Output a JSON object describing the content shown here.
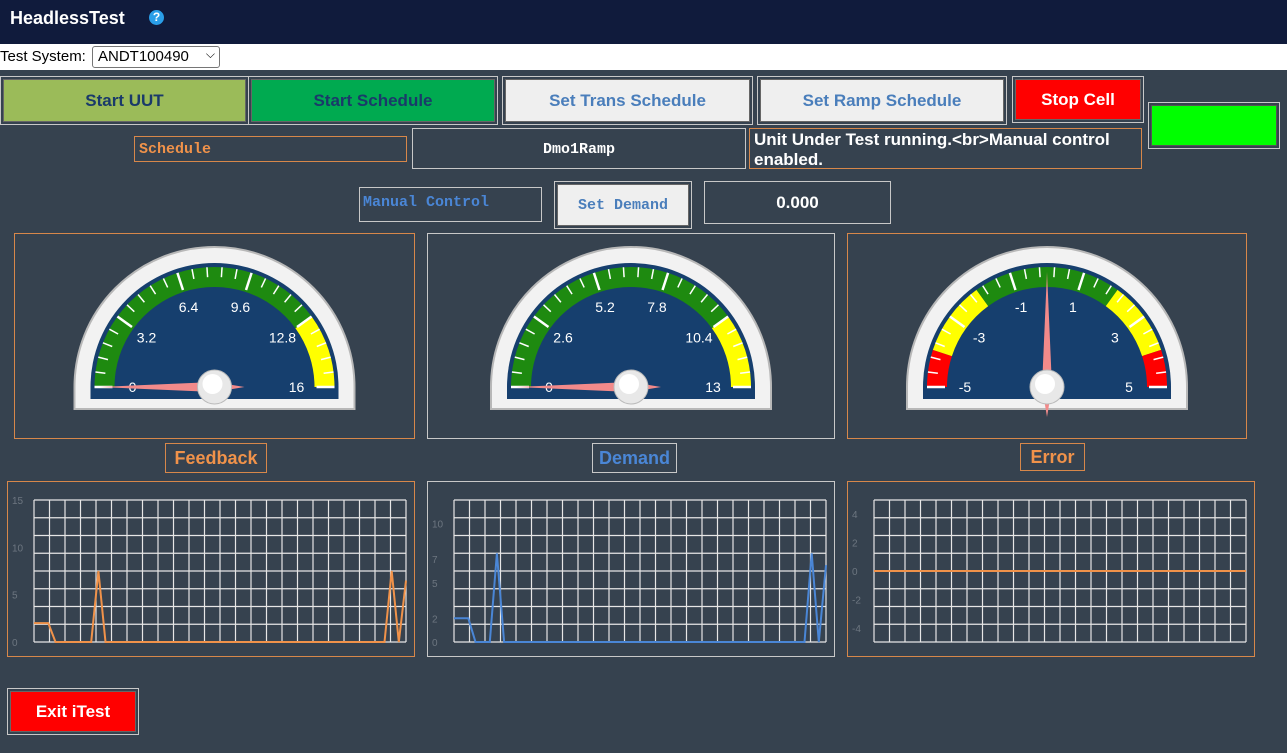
{
  "app": {
    "title": "HeadlessTest",
    "help_icon": "?"
  },
  "test_system": {
    "label": "Test System:",
    "selected": "ANDT100490"
  },
  "toolbar": {
    "start_uut": "Start UUT",
    "start_schedule": "Start Schedule",
    "set_trans_schedule": "Set Trans Schedule",
    "set_ramp_schedule": "Set Ramp Schedule",
    "stop_cell": "Stop Cell",
    "status_indicator_color": "#00ff00"
  },
  "schedule": {
    "label": "Schedule",
    "value": "Dmo1Ramp",
    "status": "Unit Under Test running.<br>Manual control enabled."
  },
  "manual": {
    "label": "Manual Control",
    "set_demand": "Set Demand",
    "value": "0.000"
  },
  "gauges": [
    {
      "name": "Feedback",
      "min": 0,
      "max": 16,
      "value": 0,
      "ticks": [
        "0",
        "3.2",
        "6.4",
        "9.6",
        "12.8",
        "16"
      ],
      "label_color": "#f0924a"
    },
    {
      "name": "Demand",
      "min": 0,
      "max": 13,
      "value": 0,
      "ticks": [
        "0",
        "2.6",
        "5.2",
        "7.8",
        "10.4",
        "13"
      ],
      "label_color": "#4a86d6"
    },
    {
      "name": "Error",
      "min": -5,
      "max": 5,
      "value": 0,
      "ticks": [
        "-5",
        "-3",
        "-1",
        "1",
        "3",
        "5"
      ],
      "label_color": "#f0924a"
    }
  ],
  "chart_data": [
    {
      "type": "line",
      "title": "Feedback",
      "ylim": [
        0,
        15
      ],
      "yticks": [
        "0",
        "5",
        "10",
        "15"
      ],
      "color": "#f0924a",
      "series": [
        {
          "values": [
            2,
            2,
            2,
            0,
            0,
            0,
            0,
            0,
            0,
            7.5,
            0,
            0,
            0,
            0,
            0,
            0,
            0,
            0,
            0,
            0,
            0,
            0,
            0,
            0,
            0,
            0,
            0,
            0,
            0,
            0,
            0,
            0,
            0,
            0,
            0,
            0,
            0,
            0,
            0,
            0,
            0,
            0,
            0,
            0,
            0,
            0,
            0,
            0,
            0,
            0,
            7.5,
            0,
            6.5
          ]
        }
      ]
    },
    {
      "type": "line",
      "title": "Demand",
      "ylim": [
        0,
        12
      ],
      "yticks": [
        "0",
        "2",
        "5",
        "7",
        "10"
      ],
      "color": "#4a86d6",
      "series": [
        {
          "values": [
            2,
            2,
            2,
            0,
            0,
            0,
            7.5,
            0,
            0,
            0,
            0,
            0,
            0,
            0,
            0,
            0,
            0,
            0,
            0,
            0,
            0,
            0,
            0,
            0,
            0,
            0,
            0,
            0,
            0,
            0,
            0,
            0,
            0,
            0,
            0,
            0,
            0,
            0,
            0,
            0,
            0,
            0,
            0,
            0,
            0,
            0,
            0,
            0,
            0,
            0,
            7.5,
            0,
            6.5
          ]
        }
      ]
    },
    {
      "type": "line",
      "title": "Error",
      "ylim": [
        -5,
        5
      ],
      "yticks": [
        "4",
        "2",
        "0",
        "-2",
        "-4"
      ],
      "color": "#f0924a",
      "series": [
        {
          "values": [
            0,
            0,
            0,
            0,
            0,
            0,
            0,
            0,
            0,
            0,
            0,
            0,
            0,
            0,
            0,
            0,
            0,
            0,
            0,
            0
          ]
        }
      ]
    }
  ],
  "exit_button": "Exit iTest"
}
